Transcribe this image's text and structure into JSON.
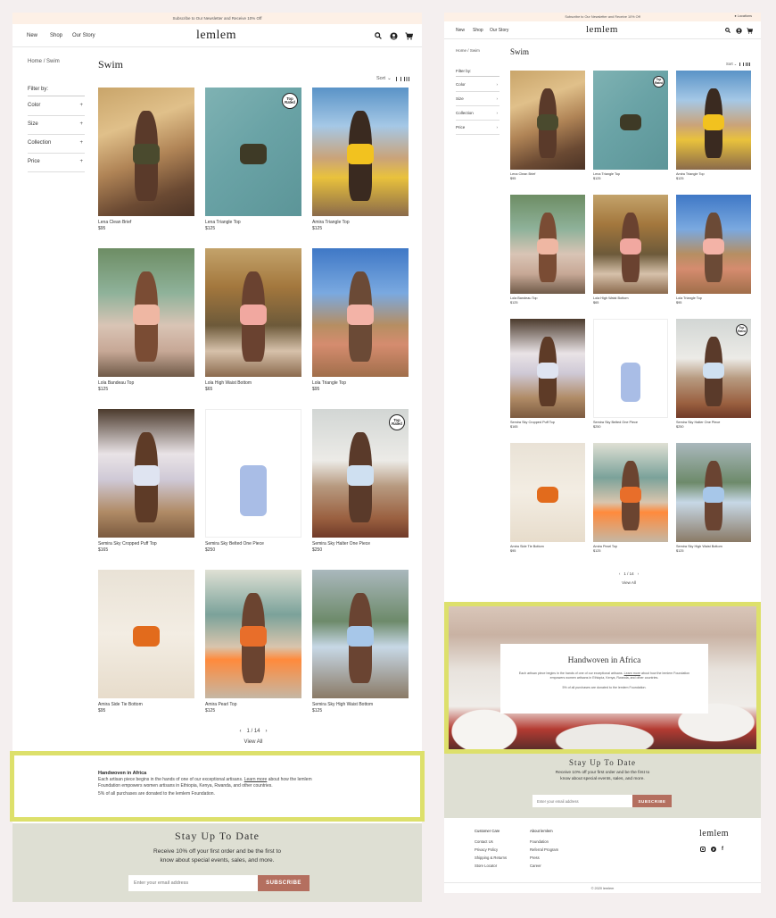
{
  "announcement": {
    "left": "Subscribe to Our Newsletter and Receive 10% Off",
    "right": "Subscribe to Our Newsletter and Receive 10% Off",
    "locator": "Locations"
  },
  "nav": {
    "new": "New",
    "shop": "Shop",
    "story": "Our Story",
    "logo": "lemlem"
  },
  "breadcrumb": {
    "home": "Home",
    "sep": "/",
    "current": "Swim"
  },
  "page_title": "Swim",
  "filter": {
    "heading": "Filter by:",
    "items": [
      {
        "label": "Color",
        "left_sign": "+",
        "right_sign": "›"
      },
      {
        "label": "Size",
        "left_sign": "+",
        "right_sign": "›"
      },
      {
        "label": "Collection",
        "left_sign": "+",
        "right_sign": "›"
      },
      {
        "label": "Price",
        "left_sign": "+",
        "right_sign": "›"
      }
    ]
  },
  "sort_label": "Sort",
  "products": [
    {
      "name": "Lena Clean Brief",
      "price": "$95",
      "badge": ""
    },
    {
      "name": "Lena Triangle Top",
      "price": "$125",
      "badge": "Top Rated"
    },
    {
      "name": "Amira Triangle Top",
      "price": "$125",
      "badge": ""
    },
    {
      "name": "Lola Bandeau Top",
      "price": "$125",
      "badge": ""
    },
    {
      "name": "Lola High Waist Bottom",
      "price": "$65",
      "badge": ""
    },
    {
      "name": "Lola Triangle Top",
      "price": "$95",
      "badge": ""
    },
    {
      "name": "Semira Sky Cropped Puff Top",
      "price": "$165",
      "badge": ""
    },
    {
      "name": "Semira Sky Belted One Piece",
      "price": "$250",
      "badge": ""
    },
    {
      "name": "Semira Sky Halter One Piece",
      "price": "$250",
      "badge": "Top Rated"
    },
    {
      "name": "Amira Side Tie Bottom",
      "price": "$95",
      "badge": ""
    },
    {
      "name": "Amira Pearl Top",
      "price": "$125",
      "badge": ""
    },
    {
      "name": "Semira Sky High Waist Bottom",
      "price": "$125",
      "badge": ""
    }
  ],
  "colors": {
    "highlight": "#dde06b",
    "accent": "#b46f5f",
    "newsletter_bg": "#dedfd3",
    "announce_bg": "#fdf0e6"
  },
  "pagination": {
    "prev": "‹",
    "text": "1 / 14",
    "next": "›",
    "view_all": "View All"
  },
  "handwoven": {
    "title": "Handwoven in Africa",
    "body_pre": "Each artisan piece begins in the hands of one of our exceptional artisans.",
    "link": "Learn more",
    "body_post": "about how the lemlem Foundation empowers women artisans in Ethiopia, Kenya, Rwanda, and other countries.",
    "note": "5% of all purchases are donated to the lemlem Foundation."
  },
  "newsletter": {
    "title": "Stay Up To Date",
    "sub1": "Receive 10% off your first order and be the first to",
    "sub2": "know about special events, sales, and more.",
    "placeholder": "Enter your email address",
    "button": "SUBSCRIBE"
  },
  "footer": {
    "col1": {
      "title": "Customer Care",
      "items": [
        "Contact Us",
        "Privacy Policy",
        "Shipping & Returns",
        "Store Locator"
      ]
    },
    "col2": {
      "title": "About lemlem",
      "items": [
        "Foundation",
        "Referral Program",
        "Press",
        "Career"
      ]
    },
    "logo": "lemlem",
    "social": [
      "instagram-icon",
      "pinterest-icon",
      "facebook-icon"
    ],
    "copyright": "© 2020 lemlem"
  }
}
